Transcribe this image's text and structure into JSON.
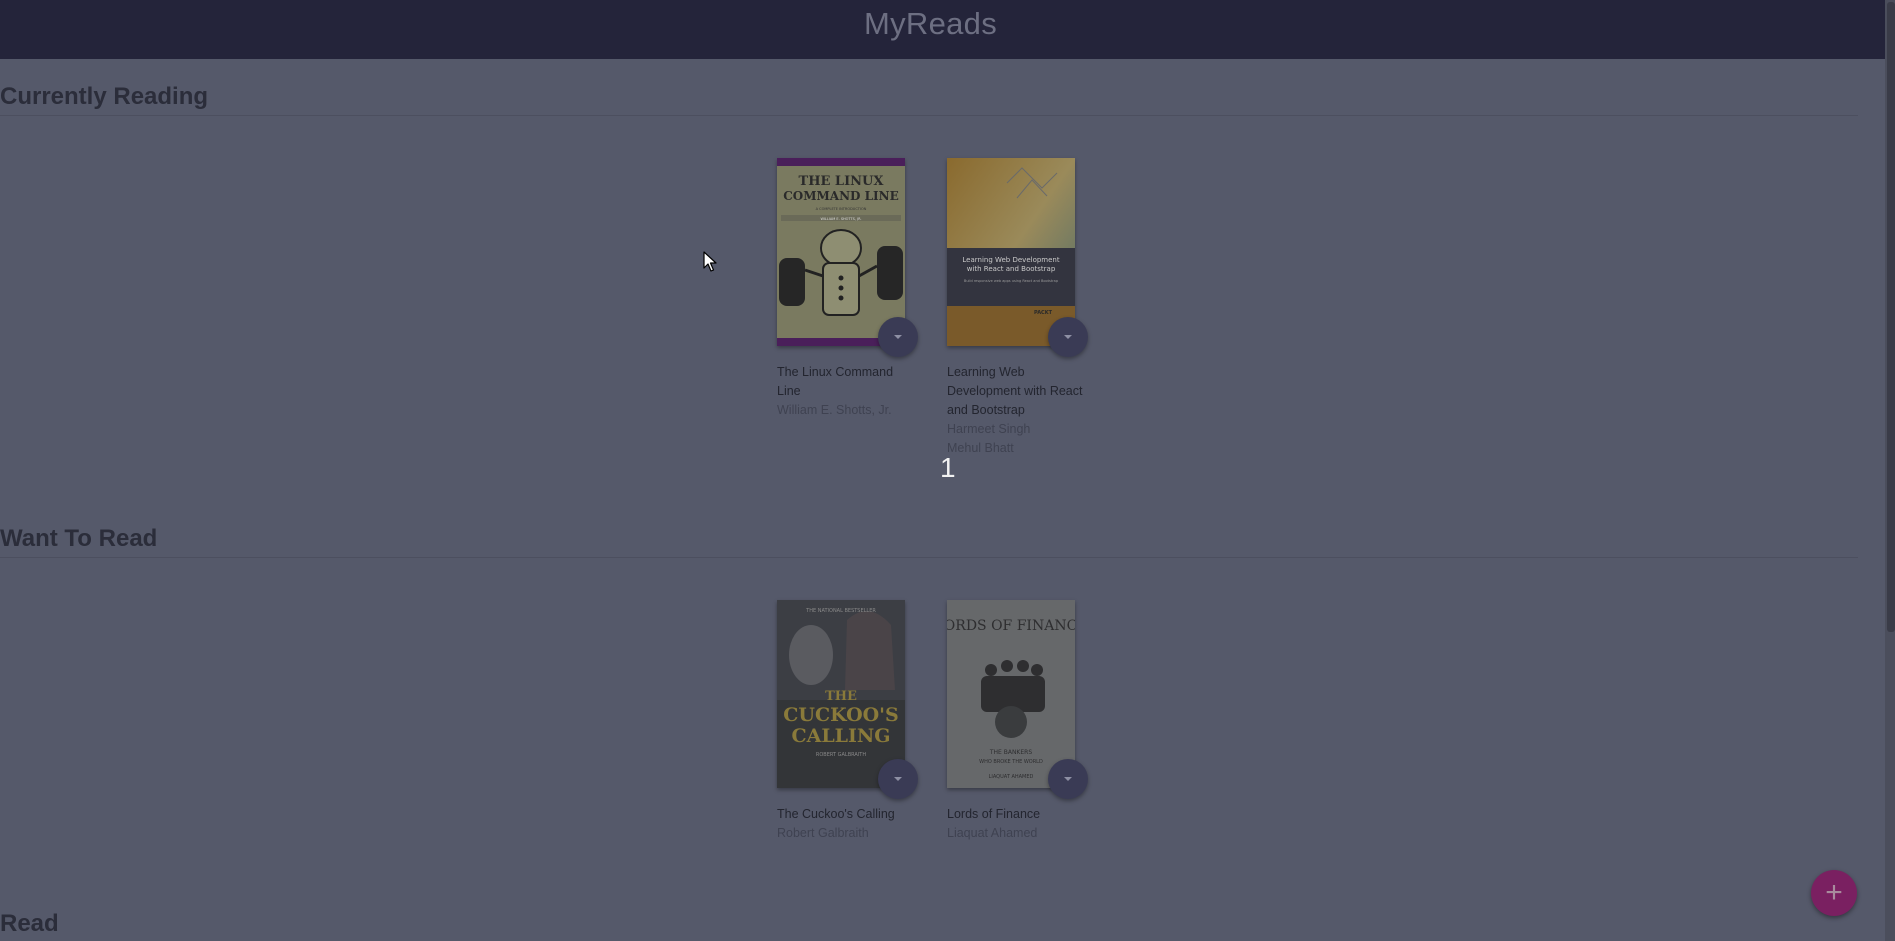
{
  "header": {
    "title": "MyReads"
  },
  "shelves": [
    {
      "title": "Currently Reading",
      "books": [
        {
          "title": "The Linux Command Line",
          "authors": [
            "William E. Shotts, Jr."
          ]
        },
        {
          "title": "Learning Web Development with React and Bootstrap",
          "authors": [
            "Harmeet Singh",
            "Mehul Bhatt"
          ]
        }
      ]
    },
    {
      "title": "Want To Read",
      "books": [
        {
          "title": "The Cuckoo's Calling",
          "authors": [
            "Robert Galbraith"
          ]
        },
        {
          "title": "Lords of Finance",
          "authors": [
            "Liaquat Ahamed"
          ]
        }
      ]
    },
    {
      "title": "Read",
      "books": []
    }
  ],
  "covers": {
    "linux": {
      "line1": "THE LINUX",
      "line2": "COMMAND LINE",
      "subtitle": "A COMPLETE INTRODUCTION",
      "author": "WILLIAM E. SHOTTS, JR."
    },
    "react": {
      "title": "Learning Web Development with React and Bootstrap",
      "subtitle": "Build responsive web apps using React and Bootstrap",
      "publisher": "PACKT"
    },
    "cuckoo": {
      "kicker": "THE NATIONAL BESTSELLER",
      "line1": "THE",
      "line2": "CUCKOO'S",
      "line3": "CALLING",
      "author": "ROBERT GALBRAITH"
    },
    "finance": {
      "line1": "LORDS OF FINANCE",
      "subtitle_1": "THE BANKERS",
      "subtitle_2": "WHO BROKE THE WORLD",
      "author": "LIAQUAT AHAMED"
    }
  },
  "overlay": {
    "page_number": "1"
  },
  "fab": {
    "label": "+"
  },
  "colors": {
    "header_bg": "#24243a",
    "page_bg": "#55596a",
    "fab_bg": "#7a2061",
    "changer_bg": "#3a3b55"
  },
  "icons": {
    "shelf_changer": "arrow-drop-down-icon",
    "cursor": "mouse-pointer-icon",
    "fab": "plus-icon"
  }
}
